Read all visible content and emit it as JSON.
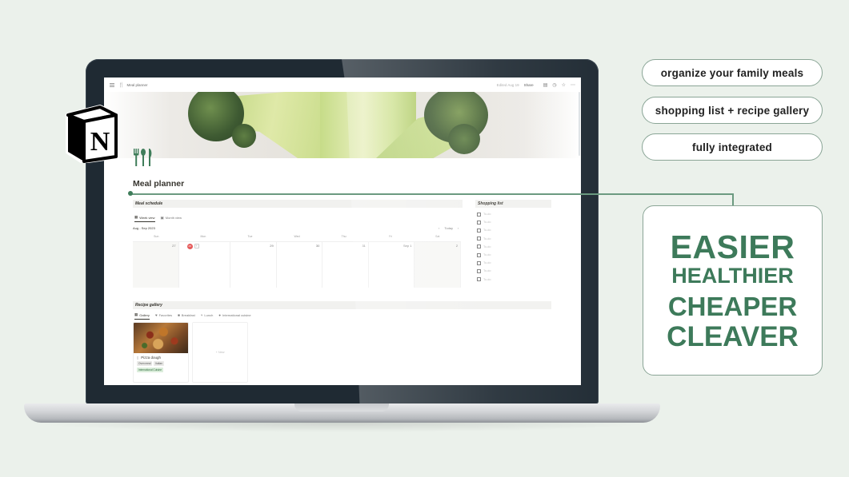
{
  "notion": {
    "breadcrumb": "Meal planner",
    "edited": "Edited Aug 19",
    "share_label": "Share",
    "page_title": "Meal planner",
    "meal_schedule": {
      "heading": "Meal schedule",
      "tabs": [
        {
          "label": "Week view",
          "icon": "table-icon",
          "active": true
        },
        {
          "label": "Month view",
          "icon": "calendar-icon",
          "active": false
        }
      ],
      "date_range": "Aug - Sep 2023",
      "today_label": "Today",
      "weekdays": [
        "Sun",
        "Mon",
        "Tue",
        "Wed",
        "Thu",
        "Fri",
        "Sat"
      ],
      "days": [
        "27",
        "28",
        "29",
        "30",
        "31",
        "Sep 1",
        "2"
      ],
      "today_index": 1
    },
    "shopping_list": {
      "heading": "Shopping list",
      "items": [
        "To-do",
        "To-do",
        "To-do",
        "To-do",
        "To-do",
        "To-do",
        "To-do",
        "To-do",
        "To-do"
      ]
    },
    "recipe_gallery": {
      "heading": "Recipe gallery",
      "tabs": [
        {
          "label": "Gallery",
          "icon": "gallery-icon",
          "active": true
        },
        {
          "label": "Favorites",
          "icon": "heart-icon",
          "active": false
        },
        {
          "label": "Breakfast",
          "icon": "breakfast-icon",
          "active": false
        },
        {
          "label": "Lunch",
          "icon": "lunch-icon",
          "active": false
        },
        {
          "label": "International cuisine",
          "icon": "globe-icon",
          "active": false
        }
      ],
      "cards": [
        {
          "title": "Pizza dough",
          "tags": [
            "Oven meal",
            "Italian"
          ],
          "green_tags": [
            "International Cuisine"
          ]
        }
      ],
      "new_label": "+ New"
    }
  },
  "marketing": {
    "pills": [
      "organize your family meals",
      "shopping list + recipe gallery",
      "fully integrated"
    ],
    "headline": [
      "EASIER",
      "HEALTHIER",
      "CHEAPER",
      "CLEAVER"
    ]
  },
  "colors": {
    "brand_green": "#3d7a5a",
    "background": "#ebf1eb",
    "today_red": "#e55b5b"
  }
}
